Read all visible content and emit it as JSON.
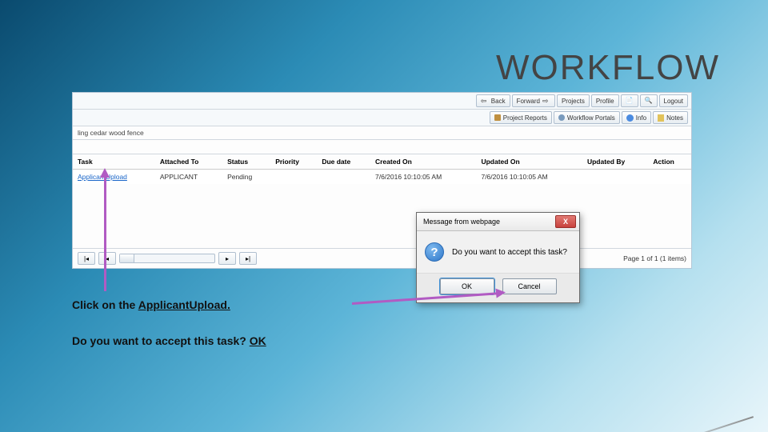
{
  "title": "WORKFLOW",
  "toolbar1": {
    "back": "Back",
    "forward": "Forward",
    "projects": "Projects",
    "profile": "Profile",
    "logout": "Logout"
  },
  "toolbar2": {
    "projectReports": "Project Reports",
    "workflowPortals": "Workflow Portals",
    "info": "Info",
    "notes": "Notes"
  },
  "context": "ling cedar wood fence",
  "columns": {
    "task": "Task",
    "attachedTo": "Attached To",
    "status": "Status",
    "priority": "Priority",
    "dueDate": "Due date",
    "createdOn": "Created On",
    "updatedOn": "Updated On",
    "updatedBy": "Updated By",
    "action": "Action"
  },
  "row": {
    "task": "ApplicantUpload",
    "attachedTo": "APPLICANT",
    "status": "Pending",
    "priority": "",
    "dueDate": "",
    "createdOn": "7/6/2016 10:10:05 AM",
    "updatedOn": "7/6/2016 10:10:05 AM",
    "updatedBy": "",
    "action": ""
  },
  "pager": {
    "info": "Page 1 of 1 (1 items)"
  },
  "dialog": {
    "title": "Message from webpage",
    "message": "Do you want to accept this task?",
    "ok": "OK",
    "cancel": "Cancel",
    "close": "X"
  },
  "instructions": {
    "line1a": "Click on the ",
    "line1b": "ApplicantUpload.",
    "line2a": "Do you want to accept this task? ",
    "line2b": "OK"
  }
}
